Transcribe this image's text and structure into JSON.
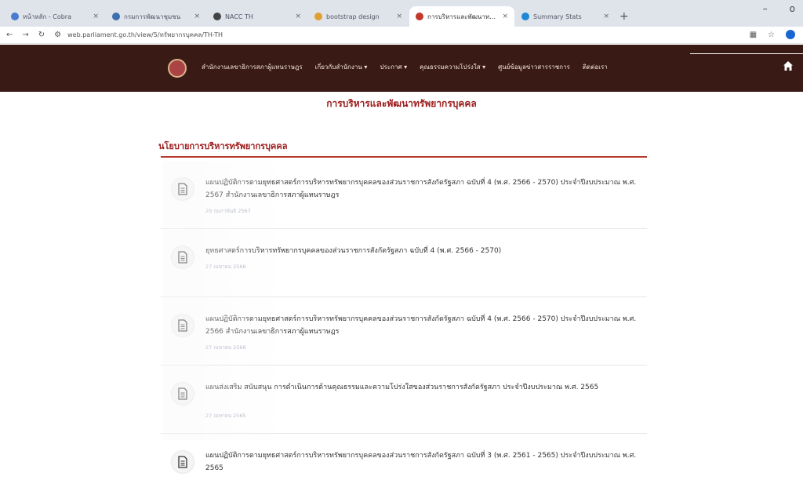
{
  "browser": {
    "tabs": [
      {
        "title": "หน้าหลัก - Cobra",
        "color": "#4a7bd0",
        "active": false
      },
      {
        "title": "กรมการพัฒนาชุมชน",
        "color": "#3a6fb0",
        "active": false
      },
      {
        "title": "NACC TH",
        "color": "#444444",
        "active": false
      },
      {
        "title": "bootstrap design",
        "color": "#e0a030",
        "active": false
      },
      {
        "title": "การบริหารและพัฒนาทรัพยากรบุคคล",
        "color": "#c0392b",
        "active": true
      },
      {
        "title": "Summary Stats",
        "color": "#1f88d6",
        "active": false
      }
    ],
    "new_tab": "+",
    "url": "web.parliament.go.th/view/5/ทรัพยากรบุคคล/TH-TH",
    "window_controls": {
      "minimize": "–",
      "maximize": "o"
    }
  },
  "site": {
    "menu": [
      "สำนักงานเลขาธิการสภาผู้แทนราษฎร",
      "เกี่ยวกับสำนักงาน ▾",
      "ประกาศ ▾",
      "คุณธรรมความโปร่งใส ▾",
      "ศูนย์ข้อมูลข่าวสารราชการ",
      "ติดต่อเรา"
    ]
  },
  "page": {
    "title": "การบริหารและพัฒนาทรัพยากรบุคคล",
    "section_title": "นโยบายการบริหารทรัพยากรบุคคล",
    "documents": [
      {
        "title": "แผนปฏิบัติการตามยุทธศาสตร์การบริหารทรัพยากรบุคคลของส่วนราชการสังกัดรัฐสภา ฉบับที่ 4 (พ.ศ. 2566 - 2570) ประจำปีงบประมาณ พ.ศ. 2567 สำนักงานเลขาธิการสภาผู้แทนราษฎร",
        "date": "29 กุมภาพันธ์ 2567"
      },
      {
        "title": "ยุทธศาสตร์การบริหารทรัพยากรบุคคลของส่วนราชการสังกัดรัฐสภา ฉบับที่ 4 (พ.ศ. 2566 - 2570)",
        "date": "27 เมษายน 2566"
      },
      {
        "title": "แผนปฏิบัติการตามยุทธศาสตร์การบริหารทรัพยากรบุคคลของส่วนราชการสังกัดรัฐสภา ฉบับที่ 4 (พ.ศ. 2566 - 2570) ประจำปีงบประมาณ พ.ศ. 2566 สำนักงานเลขาธิการสภาผู้แทนราษฎร",
        "date": "27 เมษายน 2566"
      },
      {
        "title": "แผนส่งเสริม สนับสนุน การดำเนินการด้านคุณธรรมและความโปร่งใสของส่วนราชการสังกัดรัฐสภา ประจำปีงบประมาณ พ.ศ. 2565",
        "date": "27 เมษายน 2565"
      },
      {
        "title": "แผนปฏิบัติการตามยุทธศาสตร์การบริหารทรัพยากรบุคคลของส่วนราชการสังกัดรัฐสภา ฉบับที่ 3 (พ.ศ. 2561 - 2565) ประจำปีงบประมาณ พ.ศ. 2565",
        "date": ""
      }
    ]
  },
  "colors": {
    "nav_background": "#3a1a14",
    "accent": "#9c1a1a"
  }
}
